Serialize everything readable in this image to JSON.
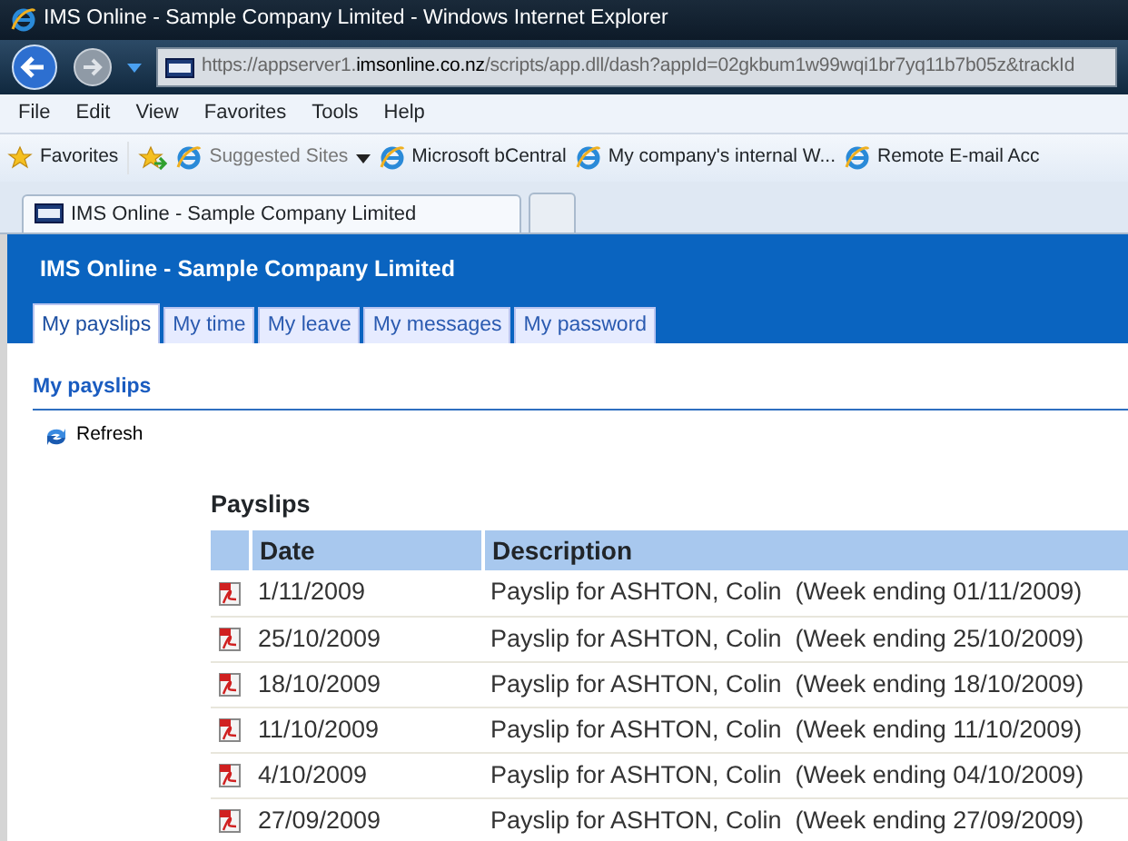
{
  "window": {
    "title": "IMS Online - Sample Company Limited - Windows Internet Explorer"
  },
  "address_bar": {
    "url_prefix": "https://appserver1.",
    "url_domain": "imsonline.co.nz",
    "url_rest": "/scripts/app.dll/dash?appId=02gkbum1w99wqi1br7yq11b7b05z&trackId"
  },
  "menu": [
    "File",
    "Edit",
    "View",
    "Favorites",
    "Tools",
    "Help"
  ],
  "favorites_bar": {
    "label": "Favorites",
    "items": [
      {
        "label": "Suggested Sites",
        "kind": "dropdown"
      },
      {
        "label": "Microsoft bCentral",
        "kind": "link"
      },
      {
        "label": "My company's internal W...",
        "kind": "link"
      },
      {
        "label": "Remote E-mail Acc",
        "kind": "link"
      }
    ]
  },
  "browser_tabs": [
    {
      "label": "IMS Online - Sample Company Limited",
      "selected": true
    }
  ],
  "page": {
    "title": "IMS Online - Sample Company Limited",
    "tabs": [
      {
        "label": "My payslips",
        "selected": true
      },
      {
        "label": "My time",
        "selected": false
      },
      {
        "label": "My leave",
        "selected": false
      },
      {
        "label": "My messages",
        "selected": false
      },
      {
        "label": "My password",
        "selected": false
      }
    ],
    "section_title": "My payslips",
    "refresh": "Refresh",
    "table_title": "Payslips",
    "table": {
      "columns": [
        "Date",
        "Description"
      ],
      "rows": [
        {
          "date": "1/11/2009",
          "description": "Payslip for ASHTON, Colin  (Week ending 01/11/2009)"
        },
        {
          "date": "25/10/2009",
          "description": "Payslip for ASHTON, Colin  (Week ending 25/10/2009)"
        },
        {
          "date": "18/10/2009",
          "description": "Payslip for ASHTON, Colin  (Week ending 18/10/2009)"
        },
        {
          "date": "11/10/2009",
          "description": "Payslip for ASHTON, Colin  (Week ending 11/10/2009)"
        },
        {
          "date": "4/10/2009",
          "description": "Payslip for ASHTON, Colin  (Week ending 04/10/2009)"
        },
        {
          "date": "27/09/2009",
          "description": "Payslip for ASHTON, Colin  (Week ending 27/09/2009)"
        }
      ]
    }
  }
}
